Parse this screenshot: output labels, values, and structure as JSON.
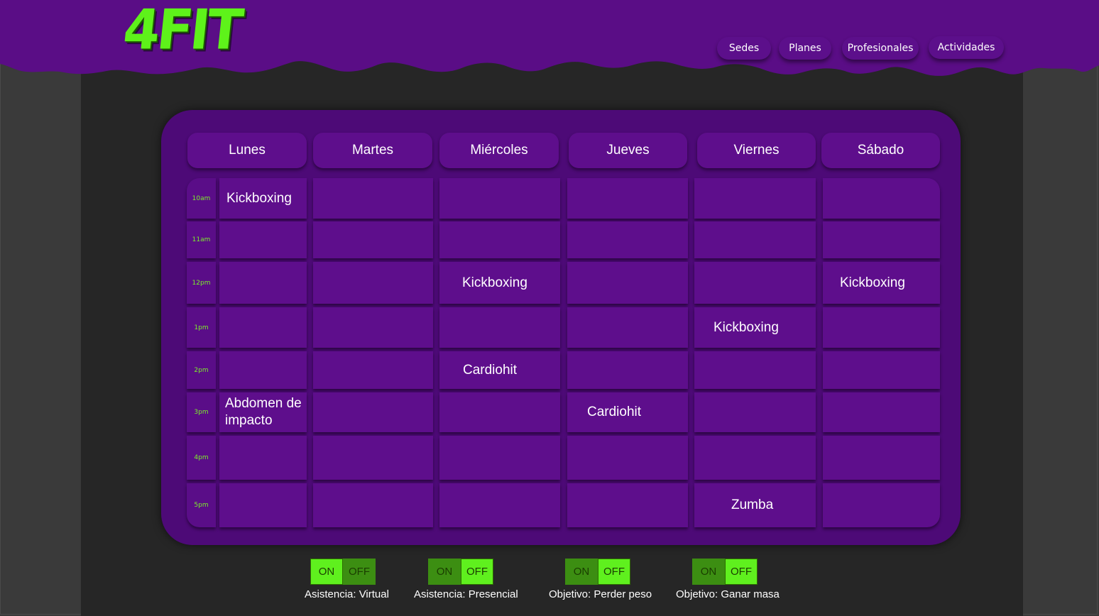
{
  "brand": {
    "logo_text": "4FIT"
  },
  "nav": {
    "items": [
      {
        "label": "Sedes"
      },
      {
        "label": "Planes"
      },
      {
        "label": "Profesionales"
      },
      {
        "label": "Actividades"
      }
    ]
  },
  "schedule": {
    "days": [
      "Lunes",
      "Martes",
      "Miércoles",
      "Jueves",
      "Viernes",
      "Sábado"
    ],
    "times": [
      "10am",
      "11am",
      "12pm",
      "1pm",
      "2pm",
      "3pm",
      "4pm",
      "5pm"
    ],
    "cells": [
      [
        "Kickboxing",
        "",
        "",
        "",
        "",
        ""
      ],
      [
        "",
        "",
        "",
        "",
        "",
        ""
      ],
      [
        "",
        "",
        "Kickboxing",
        "",
        "",
        "Kickboxing"
      ],
      [
        "",
        "",
        "",
        "",
        "Kickboxing",
        ""
      ],
      [
        "",
        "",
        "Cardiohit",
        "",
        "",
        ""
      ],
      [
        "Abdomen de impacto",
        "",
        "",
        "Cardiohit",
        "",
        ""
      ],
      [
        "",
        "",
        "",
        "",
        "",
        ""
      ],
      [
        "",
        "",
        "",
        "",
        "Zumba",
        ""
      ]
    ]
  },
  "filters": [
    {
      "on_label": "ON",
      "off_label": "OFF",
      "state": "on",
      "caption": "Asistencia: Virtual"
    },
    {
      "on_label": "ON",
      "off_label": "OFF",
      "state": "off",
      "caption": "Asistencia: Presencial"
    },
    {
      "on_label": "ON",
      "off_label": "OFF",
      "state": "off",
      "caption": "Objetivo: Perder peso"
    },
    {
      "on_label": "ON",
      "off_label": "OFF",
      "state": "off",
      "caption": "Objetivo: Ganar masa"
    }
  ],
  "colors": {
    "brand_purple": "#5e0e8c",
    "card_purple": "#4d0a77",
    "accent_green": "#5ff01e",
    "background": "#262626"
  }
}
